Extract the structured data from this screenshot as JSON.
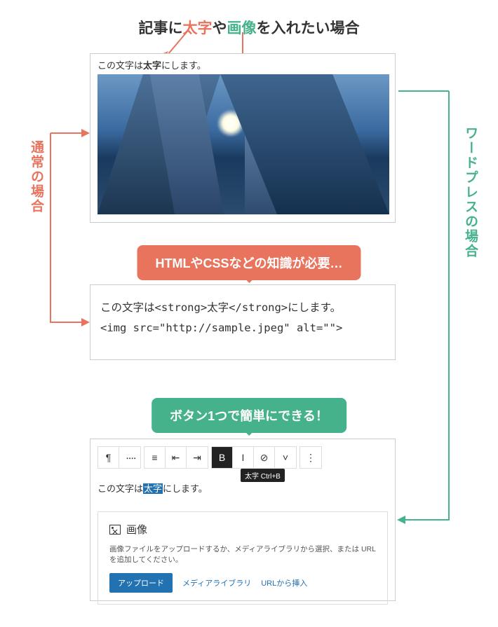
{
  "title": {
    "p1": "記事に",
    "a1": "太字",
    "p2": "や",
    "a2": "画像",
    "p3": "を入れたい場合"
  },
  "sideLabels": {
    "left": "通常の場合",
    "right": "ワードプレスの場合"
  },
  "preview": {
    "text_before": "この文字は",
    "text_bold": "太字",
    "text_after": "にします。"
  },
  "callouts": {
    "red": "HTMLやCSSなどの知識が必要…",
    "green": "ボタン1つで簡単にできる！"
  },
  "code": {
    "line1": "この文字は<strong>太字</strong>にします。",
    "line2": "<img src=\"http://sample.jpeg\" alt=\"\">"
  },
  "editor": {
    "toolbar": {
      "para": "¶",
      "dots": "᠁",
      "alignL": "≡",
      "indentL": "⇤",
      "indentR": "⇥",
      "bold": "B",
      "italic": "I",
      "link": "⊘",
      "chev": "˅",
      "more": "⋮"
    },
    "tooltip": "太字 Ctrl+B",
    "line_before": "この文字は",
    "line_sel": "太字",
    "line_after": "にします。",
    "imageBlock": {
      "title": "画像",
      "desc": "画像ファイルをアップロードするか、メディアライブラリから選択、または URL を追加してください。",
      "upload": "アップロード",
      "media": "メディアライブラリ",
      "url": "URLから挿入"
    }
  }
}
